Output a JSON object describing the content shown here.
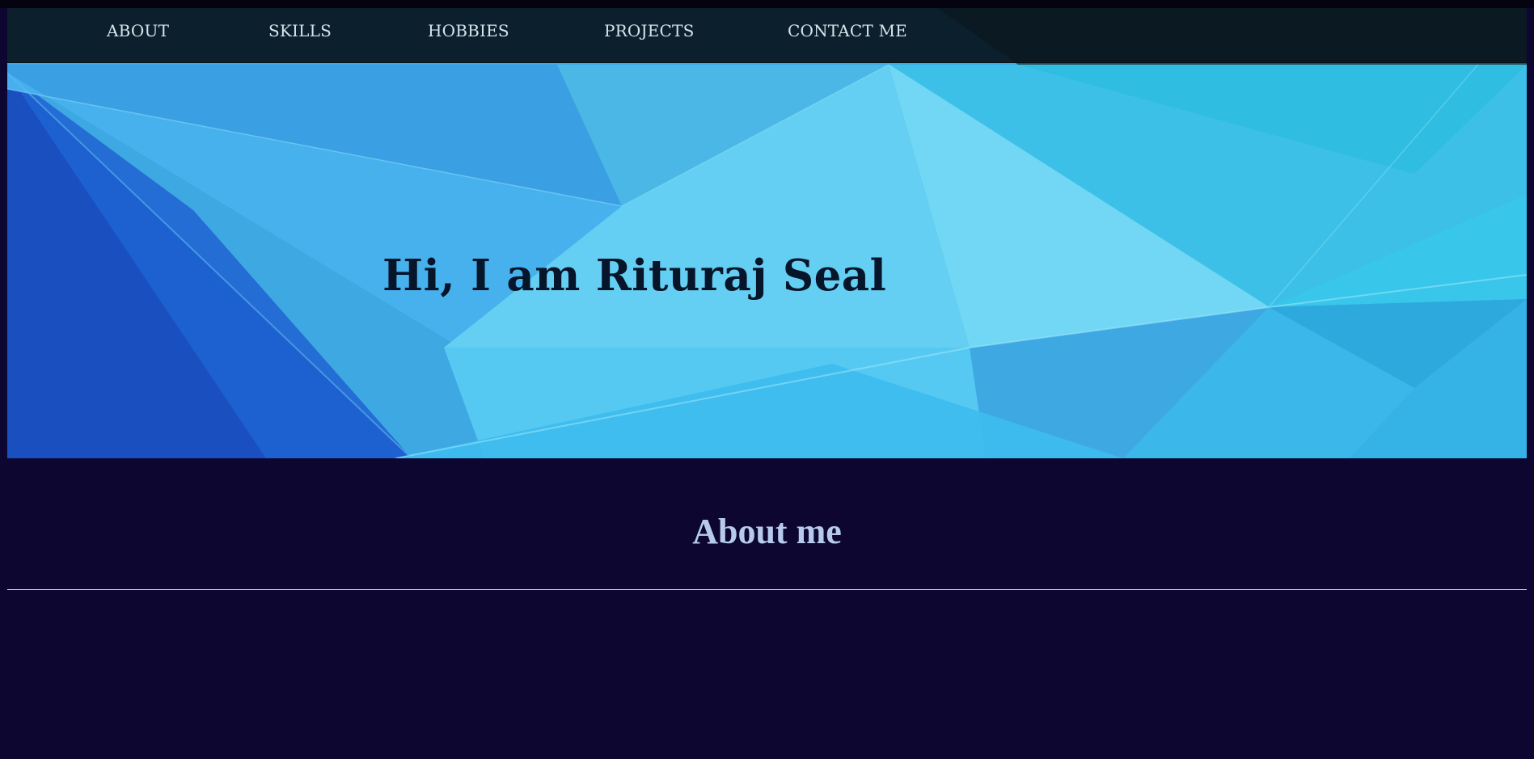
{
  "nav": {
    "items": [
      {
        "label": "ABOUT"
      },
      {
        "label": "SKILLS"
      },
      {
        "label": "HOBBIES"
      },
      {
        "label": "PROJECTS"
      },
      {
        "label": "CONTACT ME"
      }
    ]
  },
  "hero": {
    "title": "Hi, I am Rituraj Seal"
  },
  "about": {
    "heading": "About me"
  },
  "colors": {
    "page_background": "#0c0630",
    "hero_accent": "#3fb2e8",
    "nav_text": "#d6e4ec",
    "heading_text": "#b7c9ec"
  }
}
